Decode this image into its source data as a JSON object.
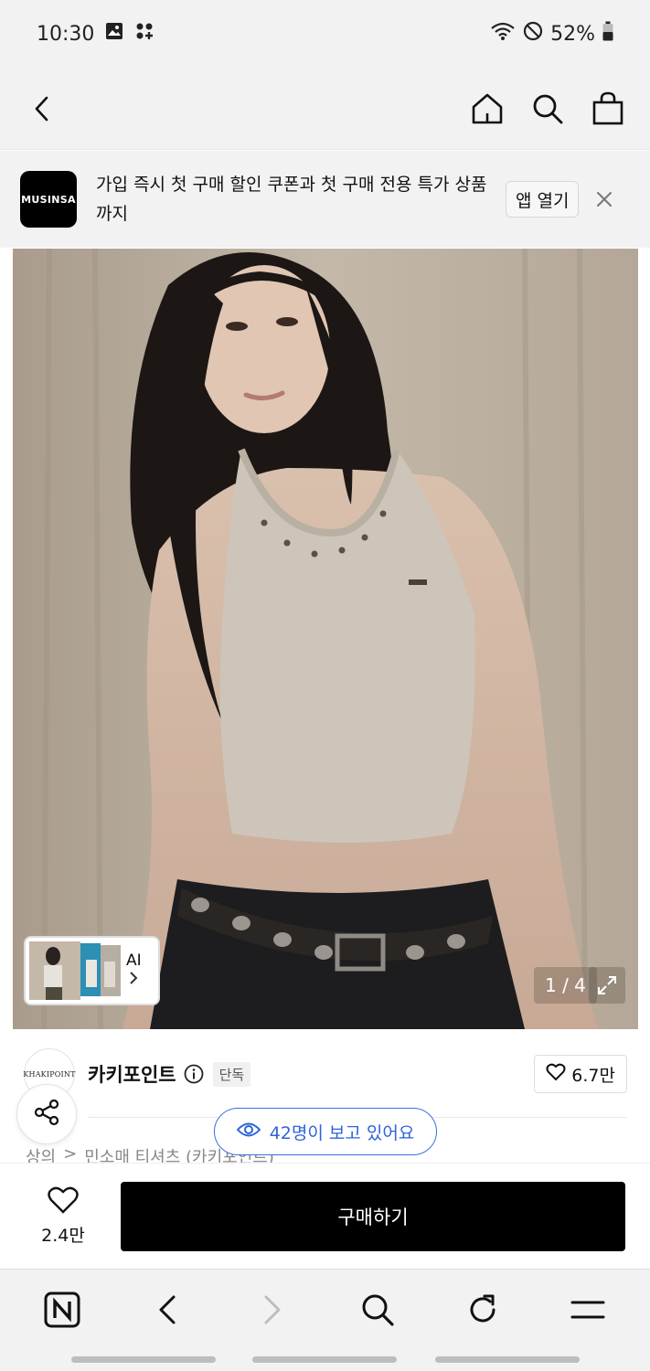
{
  "status_bar": {
    "time": "10:30",
    "battery": "52%",
    "icons": [
      "gallery-icon",
      "notification-icon",
      "wifi-icon",
      "dnd-icon",
      "battery-icon"
    ]
  },
  "top_nav": {
    "icons": [
      "back-icon",
      "home-icon",
      "search-icon",
      "bag-icon"
    ]
  },
  "app_banner": {
    "logo_text": "MUSINSA",
    "message": "가입 즉시 첫 구매 할인 쿠폰과 첫 구매 전용 특가 상품까지",
    "open_button": "앱 열기",
    "close_icon": "close-icon"
  },
  "gallery": {
    "ai_label": "AI",
    "page_indicator": "1 / 4",
    "expand_icon": "expand-icon"
  },
  "brand": {
    "logo_text": "KHAKIPOINT",
    "name": "카키포인트",
    "badge": "단독",
    "likes": "6.7만"
  },
  "viewers": {
    "text": "42명이 보고 있어요"
  },
  "breadcrumb": {
    "items": [
      "상의",
      ">",
      "민소매 티셔츠 (카키포인트)"
    ]
  },
  "buy_bar": {
    "wish_count": "2.4만",
    "buy_label": "구매하기"
  },
  "browser_bar": {
    "icons": [
      "naver-icon",
      "back-arrow-icon",
      "forward-arrow-icon",
      "search-icon",
      "refresh-icon",
      "menu-icon"
    ]
  },
  "colors": {
    "accent_blue": "#2e63d8",
    "buy_black": "#000000",
    "chrome_gray": "#f2f2f2"
  }
}
